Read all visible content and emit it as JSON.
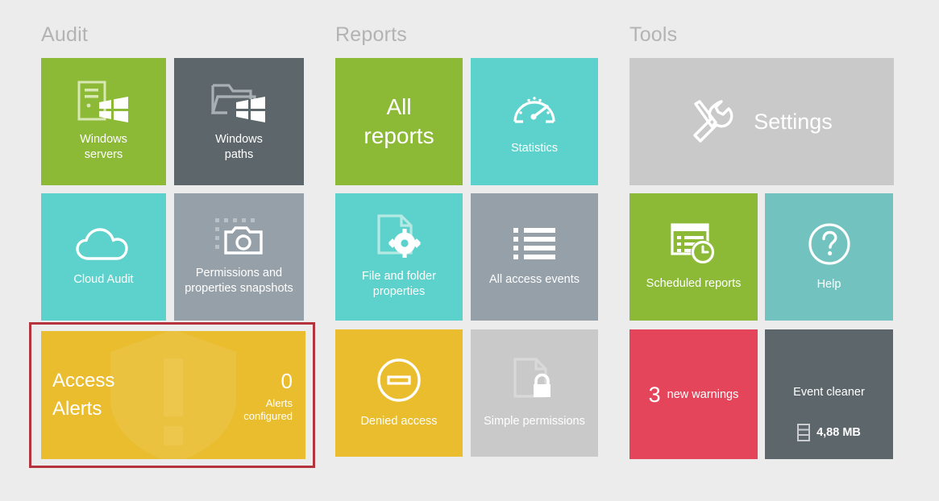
{
  "columns": [
    {
      "title": "Audit"
    },
    {
      "title": "Reports"
    },
    {
      "title": "Tools"
    }
  ],
  "audit": {
    "windows_servers": {
      "label": "Windows\nservers",
      "line1": "Windows",
      "line2": "servers",
      "color": "#8cba37",
      "icon": "server-windows-icon"
    },
    "windows_paths": {
      "line1": "Windows",
      "line2": "paths",
      "color": "#5d666b",
      "icon": "folder-windows-icon"
    },
    "cloud_audit": {
      "label": "Cloud Audit",
      "color": "#5dd1cb",
      "icon": "cloud-icon"
    },
    "snapshots": {
      "line1": "Permissions and",
      "line2": "properties snapshots",
      "color": "#96a0a8",
      "icon": "camera-icon"
    },
    "access_alerts": {
      "title_line1": "Access",
      "title_line2": "Alerts",
      "count": "0",
      "sub_line1": "Alerts",
      "sub_line2": "configured",
      "color": "#e9bd2e",
      "icon": "shield-alert-icon",
      "highlight_color": "#b5333c",
      "highlighted": true
    }
  },
  "reports": {
    "all_reports": {
      "line1": "All",
      "line2": "reports",
      "color": "#8cba37"
    },
    "statistics": {
      "label": "Statistics",
      "color": "#5dd1cb",
      "icon": "gauge-icon"
    },
    "file_folder_properties": {
      "line1": "File and folder",
      "line2": "properties",
      "color": "#5dd1cb",
      "icon": "document-gear-icon"
    },
    "all_access_events": {
      "label": "All access events",
      "color": "#96a0a8",
      "icon": "list-icon"
    },
    "denied_access": {
      "label": "Denied access",
      "color": "#e9bd2e",
      "icon": "deny-circle-icon"
    },
    "simple_permissions": {
      "label": "Simple permissions",
      "color": "#c9c9c9",
      "icon": "document-lock-icon"
    }
  },
  "tools": {
    "settings": {
      "label": "Settings",
      "color": "#c9c9c9",
      "icon": "tools-icon"
    },
    "scheduled_reports": {
      "label": "Scheduled reports",
      "color": "#8cba37",
      "icon": "report-clock-icon"
    },
    "help": {
      "label": "Help",
      "color": "#72c2c0",
      "icon": "question-circle-icon"
    },
    "warnings": {
      "count": "3",
      "label": "new warnings",
      "color": "#e4455b"
    },
    "event_cleaner": {
      "label": "Event cleaner",
      "size": "4,88 MB",
      "color": "#5d666b",
      "icon": "database-icon"
    }
  },
  "theme": {
    "background": "#ececec",
    "column_title_color": "#b3b3b3",
    "tile_text_color": "#ffffff"
  }
}
